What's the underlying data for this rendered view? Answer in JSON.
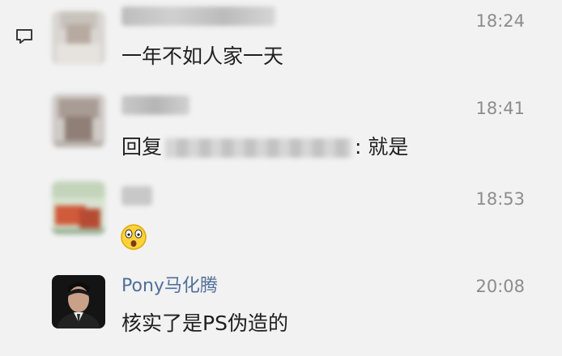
{
  "messages": [
    {
      "name": "",
      "time": "18:24",
      "text": "一年不如人家一天"
    },
    {
      "name": "",
      "time": "18:41",
      "text_prefix": "回复",
      "text_suffix": ": 就是"
    },
    {
      "name": "",
      "time": "18:53",
      "text": "",
      "emoji": "shocked-face"
    },
    {
      "name": "Pony马化腾",
      "time": "20:08",
      "text": "核实了是PS伪造的"
    }
  ],
  "icons": {
    "quote": "quote-bubble-icon"
  },
  "colors": {
    "name": "#4f6f9a",
    "time": "#8c8c8c",
    "background": "#f2f2f2"
  }
}
